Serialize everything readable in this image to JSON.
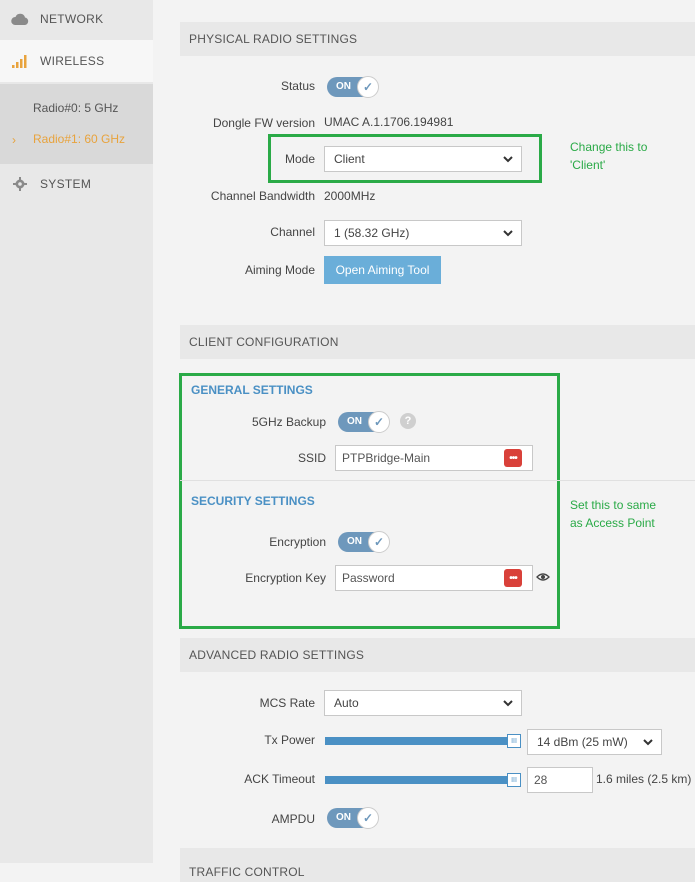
{
  "sidebar": {
    "network_label": "NETWORK",
    "wireless_label": "WIRELESS",
    "radio0_label": "Radio#0: 5 GHz",
    "radio1_label": "Radio#1: 60 GHz",
    "system_label": "SYSTEM"
  },
  "physical": {
    "header": "PHYSICAL RADIO SETTINGS",
    "status_label": "Status",
    "status_toggle": "ON",
    "fw_label": "Dongle FW version",
    "fw_value": "UMAC A.1.1706.194981",
    "mode_label": "Mode",
    "mode_value": "Client",
    "bandwidth_label": "Channel Bandwidth",
    "bandwidth_value": "2000MHz",
    "channel_label": "Channel",
    "channel_value": "1 (58.32 GHz)",
    "aiming_label": "Aiming Mode",
    "aiming_button": "Open Aiming Tool"
  },
  "annotations": {
    "mode_note_line1": "Change this to",
    "mode_note_line2": "'Client'",
    "ssid_note_line1": "Set this to same",
    "ssid_note_line2": "as Access Point"
  },
  "client": {
    "header": "CLIENT CONFIGURATION",
    "general_title": "GENERAL SETTINGS",
    "backup_label": "5GHz Backup",
    "backup_toggle": "ON",
    "ssid_label": "SSID",
    "ssid_value": "PTPBridge-Main",
    "security_title": "SECURITY SETTINGS",
    "encryption_label": "Encryption",
    "encryption_toggle": "ON",
    "key_label": "Encryption Key",
    "key_value": "Password"
  },
  "advanced": {
    "header": "ADVANCED RADIO SETTINGS",
    "mcs_label": "MCS Rate",
    "mcs_value": "Auto",
    "txpower_label": "Tx Power",
    "txpower_value": "14 dBm (25 mW)",
    "ack_label": "ACK Timeout",
    "ack_value": "28",
    "ack_distance": "1.6 miles (2.5 km)",
    "ampdu_label": "AMPDU",
    "ampdu_toggle": "ON"
  },
  "traffic": {
    "header": "TRAFFIC CONTROL"
  },
  "colors": {
    "accent": "#4a90c4",
    "toggle": "#6e98bc",
    "button": "#6aaed9",
    "annotation": "#2aaa47",
    "active_nav": "#e8a33d",
    "pw_button": "#d9413a"
  }
}
